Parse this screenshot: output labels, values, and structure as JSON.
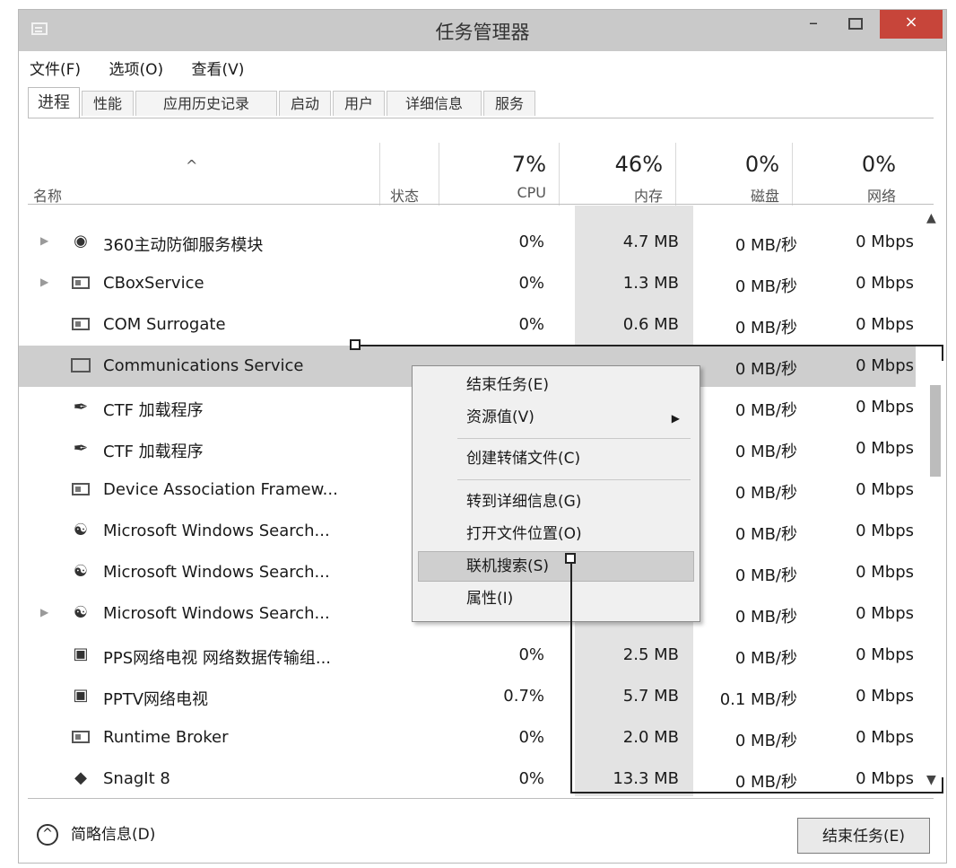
{
  "window": {
    "title": "任务管理器",
    "minimize": "–",
    "close": "×"
  },
  "menu": [
    "文件(F)",
    "选项(O)",
    "查看(V)"
  ],
  "tabs": [
    "进程",
    "性能",
    "应用历史记录",
    "启动",
    "用户",
    "详细信息",
    "服务"
  ],
  "columns": {
    "sort_indicator": "^",
    "name": "名称",
    "status": "状态",
    "cpu": {
      "pct": "7%",
      "label": "CPU"
    },
    "memory": {
      "pct": "46%",
      "label": "内存"
    },
    "disk": {
      "pct": "0%",
      "label": "磁盘"
    },
    "network": {
      "pct": "0%",
      "label": "网络"
    }
  },
  "processes": [
    {
      "name": "360主动防御服务模块",
      "icon": "shield-icon",
      "expand": true,
      "cpu": "0%",
      "mem": "4.7 MB",
      "disk": "0 MB/秒",
      "net": "0 Mbps"
    },
    {
      "name": "CBoxService",
      "icon": "app-window-icon",
      "expand": true,
      "cpu": "0%",
      "mem": "1.3 MB",
      "disk": "0 MB/秒",
      "net": "0 Mbps"
    },
    {
      "name": "COM Surrogate",
      "icon": "app-window-icon",
      "expand": false,
      "cpu": "0%",
      "mem": "0.6 MB",
      "disk": "0 MB/秒",
      "net": "0 Mbps"
    },
    {
      "name": "Communications Service",
      "icon": "mail-icon",
      "expand": false,
      "cpu": "",
      "mem": "",
      "disk": "0 MB/秒",
      "net": "0 Mbps",
      "selected": true
    },
    {
      "name": "CTF 加载程序",
      "icon": "pen-icon",
      "expand": false,
      "cpu": "",
      "mem": "",
      "disk": "0 MB/秒",
      "net": "0 Mbps"
    },
    {
      "name": "CTF 加载程序",
      "icon": "pen-icon",
      "expand": false,
      "cpu": "",
      "mem": "",
      "disk": "0 MB/秒",
      "net": "0 Mbps"
    },
    {
      "name": "Device Association Framew...",
      "icon": "app-window-icon",
      "expand": false,
      "cpu": "",
      "mem": "",
      "disk": "0 MB/秒",
      "net": "0 Mbps"
    },
    {
      "name": "Microsoft Windows Search...",
      "icon": "search-service-icon",
      "expand": false,
      "cpu": "",
      "mem": "",
      "disk": "0 MB/秒",
      "net": "0 Mbps"
    },
    {
      "name": "Microsoft Windows Search...",
      "icon": "search-service-icon",
      "expand": false,
      "cpu": "",
      "mem": "",
      "disk": "0 MB/秒",
      "net": "0 Mbps"
    },
    {
      "name": "Microsoft Windows Search...",
      "icon": "search-service-icon",
      "expand": true,
      "cpu": "",
      "mem": "",
      "disk": "0 MB/秒",
      "net": "0 Mbps"
    },
    {
      "name": "PPS网络电视 网络数据传输组...",
      "icon": "tv-icon",
      "expand": false,
      "cpu": "0%",
      "mem": "2.5 MB",
      "disk": "0 MB/秒",
      "net": "0 Mbps"
    },
    {
      "name": "PPTV网络电视",
      "icon": "tv-icon",
      "expand": false,
      "cpu": "0.7%",
      "mem": "5.7 MB",
      "disk": "0.1 MB/秒",
      "net": "0 Mbps"
    },
    {
      "name": "Runtime Broker",
      "icon": "app-window-icon",
      "expand": false,
      "cpu": "0%",
      "mem": "2.0 MB",
      "disk": "0 MB/秒",
      "net": "0 Mbps"
    },
    {
      "name": "SnagIt 8",
      "icon": "snagit-icon",
      "expand": false,
      "cpu": "0%",
      "mem": "13.3 MB",
      "disk": "0 MB/秒",
      "net": "0 Mbps"
    }
  ],
  "context_menu": {
    "end_task": "结束任务(E)",
    "resource_values": "资源值(V)",
    "create_dump": "创建转储文件(C)",
    "go_to_details": "转到详细信息(G)",
    "open_file_location": "打开文件位置(O)",
    "search_online": "联机搜索(S)",
    "properties": "属性(I)"
  },
  "footer": {
    "fewer_details": "简略信息(D)",
    "end_task_button": "结束任务(E)"
  }
}
